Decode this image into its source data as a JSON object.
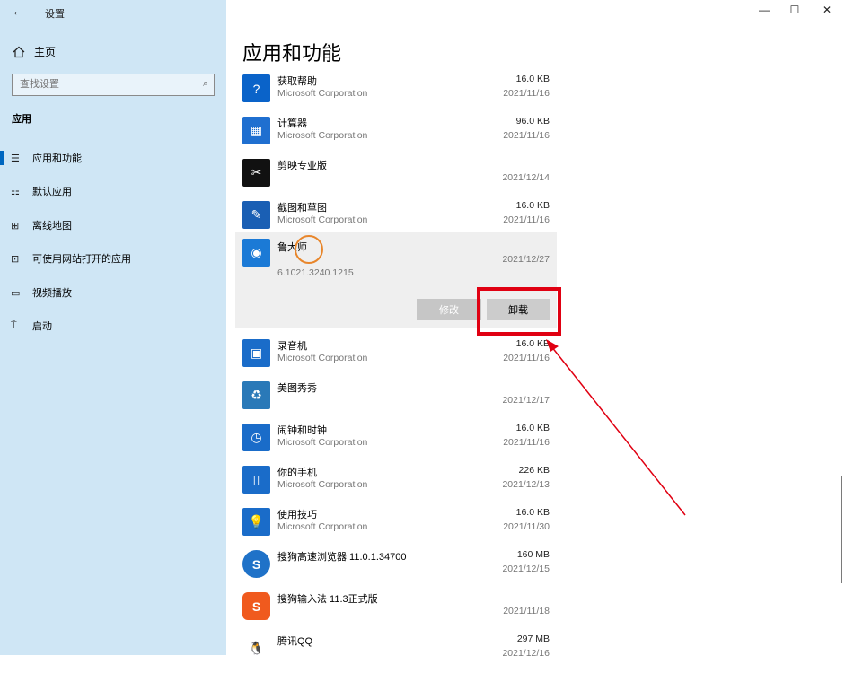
{
  "window": {
    "title": "设置",
    "back_icon": "←",
    "minimize_icon": "—",
    "maximize_icon": "☐",
    "close_icon": "✕"
  },
  "sidebar": {
    "home_label": "主页",
    "search_placeholder": "查找设置",
    "section_title": "应用",
    "items": [
      {
        "icon": "☰",
        "label": "应用和功能",
        "active": true
      },
      {
        "icon": "☷",
        "label": "默认应用"
      },
      {
        "icon": "⊞",
        "label": "离线地图"
      },
      {
        "icon": "⊡",
        "label": "可使用网站打开的应用"
      },
      {
        "icon": "▭",
        "label": "视频播放"
      },
      {
        "icon": "⍑",
        "label": "启动"
      }
    ]
  },
  "main": {
    "title": "应用和功能",
    "apps": [
      {
        "name": "获取帮助",
        "publisher": "Microsoft Corporation",
        "size": "16.0 KB",
        "date": "2021/11/16",
        "icon": "?",
        "color": "#0a63c9"
      },
      {
        "name": "计算器",
        "publisher": "Microsoft Corporation",
        "size": "96.0 KB",
        "date": "2021/11/16",
        "icon": "▦",
        "color": "#1f6fd0"
      },
      {
        "name": "剪映专业版",
        "publisher": "",
        "size": "",
        "date": "2021/12/14",
        "icon": "✂",
        "color": "#111111"
      },
      {
        "name": "截图和草图",
        "publisher": "Microsoft Corporation",
        "size": "16.0 KB",
        "date": "2021/11/16",
        "icon": "✎",
        "color": "#1a5fb4"
      },
      {
        "name": "鲁大师",
        "publisher": "6.1021.3240.1215",
        "size": "",
        "date": "2021/12/27",
        "icon": "◉",
        "color": "#1b7ad6"
      },
      {
        "name": "录音机",
        "publisher": "Microsoft Corporation",
        "size": "16.0 KB",
        "date": "2021/11/16",
        "icon": "▣",
        "color": "#1a6cc9"
      },
      {
        "name": "美图秀秀",
        "publisher": "",
        "size": "",
        "date": "2021/12/17",
        "icon": "♻",
        "color": "#2a79b8"
      },
      {
        "name": "闹钟和时钟",
        "publisher": "Microsoft Corporation",
        "size": "16.0 KB",
        "date": "2021/11/16",
        "icon": "◷",
        "color": "#1a6cc9"
      },
      {
        "name": "你的手机",
        "publisher": "Microsoft Corporation",
        "size": "226 KB",
        "date": "2021/12/13",
        "icon": "▯",
        "color": "#1a6cc9"
      },
      {
        "name": "使用技巧",
        "publisher": "Microsoft Corporation",
        "size": "16.0 KB",
        "date": "2021/11/30",
        "icon": "💡",
        "color": "#1a6cc9"
      },
      {
        "name": "搜狗高速浏览器 11.0.1.34700",
        "publisher": "",
        "size": "160 MB",
        "date": "2021/12/15",
        "icon": "S",
        "color": "#1f72c8"
      },
      {
        "name": "搜狗输入法 11.3正式版",
        "publisher": "",
        "size": "",
        "date": "2021/11/18",
        "icon": "S",
        "color": "#f05a1e"
      },
      {
        "name": "腾讯QQ",
        "publisher": "",
        "size": "297 MB",
        "date": "2021/12/16",
        "icon": "🐧",
        "color": "#ffffff"
      }
    ],
    "buttons": {
      "modify": "修改",
      "uninstall": "卸载"
    }
  },
  "colors": {
    "sidebar_bg": "#cfe6f5",
    "accent": "#0067c0",
    "highlight": "#e00012"
  }
}
